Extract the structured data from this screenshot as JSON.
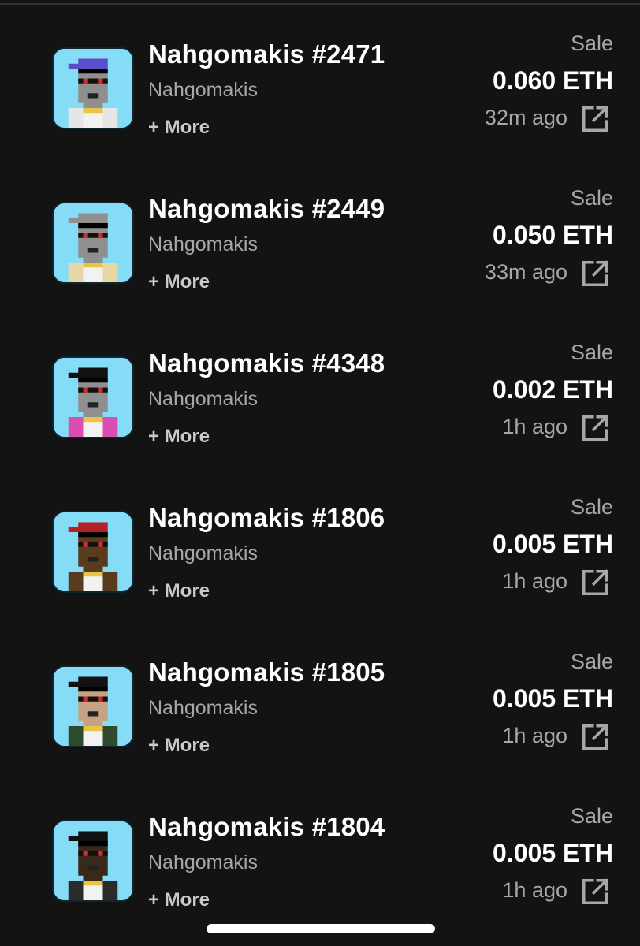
{
  "activity": [
    {
      "name": "Nahgomakis #2471",
      "collection": "Nahgomakis",
      "more": "+ More",
      "event": "Sale",
      "price": "0.060 ETH",
      "time": "32m ago",
      "avatar": {
        "cap": "#5a4fc7",
        "skin": "#8f8f8f",
        "body": "#e6e6e6"
      }
    },
    {
      "name": "Nahgomakis #2449",
      "collection": "Nahgomakis",
      "more": "+ More",
      "event": "Sale",
      "price": "0.050 ETH",
      "time": "33m ago",
      "avatar": {
        "cap": "#8f8f8f",
        "skin": "#8f8f8f",
        "body": "#e8d7a6"
      }
    },
    {
      "name": "Nahgomakis #4348",
      "collection": "Nahgomakis",
      "more": "+ More",
      "event": "Sale",
      "price": "0.002 ETH",
      "time": "1h ago",
      "avatar": {
        "cap": "#111111",
        "skin": "#8f8f8f",
        "body": "#d94fb1"
      }
    },
    {
      "name": "Nahgomakis #1806",
      "collection": "Nahgomakis",
      "more": "+ More",
      "event": "Sale",
      "price": "0.005 ETH",
      "time": "1h ago",
      "avatar": {
        "cap": "#b51f28",
        "skin": "#5a3b1e",
        "body": "#5a3b1e"
      }
    },
    {
      "name": "Nahgomakis #1805",
      "collection": "Nahgomakis",
      "more": "+ More",
      "event": "Sale",
      "price": "0.005 ETH",
      "time": "1h ago",
      "avatar": {
        "cap": "#111111",
        "skin": "#c7a183",
        "body": "#2e4b2f"
      }
    },
    {
      "name": "Nahgomakis #1804",
      "collection": "Nahgomakis",
      "more": "+ More",
      "event": "Sale",
      "price": "0.005 ETH",
      "time": "1h ago",
      "avatar": {
        "cap": "#111111",
        "skin": "#3a2818",
        "body": "#2b2b2b"
      }
    }
  ],
  "theme": {
    "background": "#131313",
    "thumb_bg": "#84dcf6",
    "muted": "#a7a7a7"
  }
}
